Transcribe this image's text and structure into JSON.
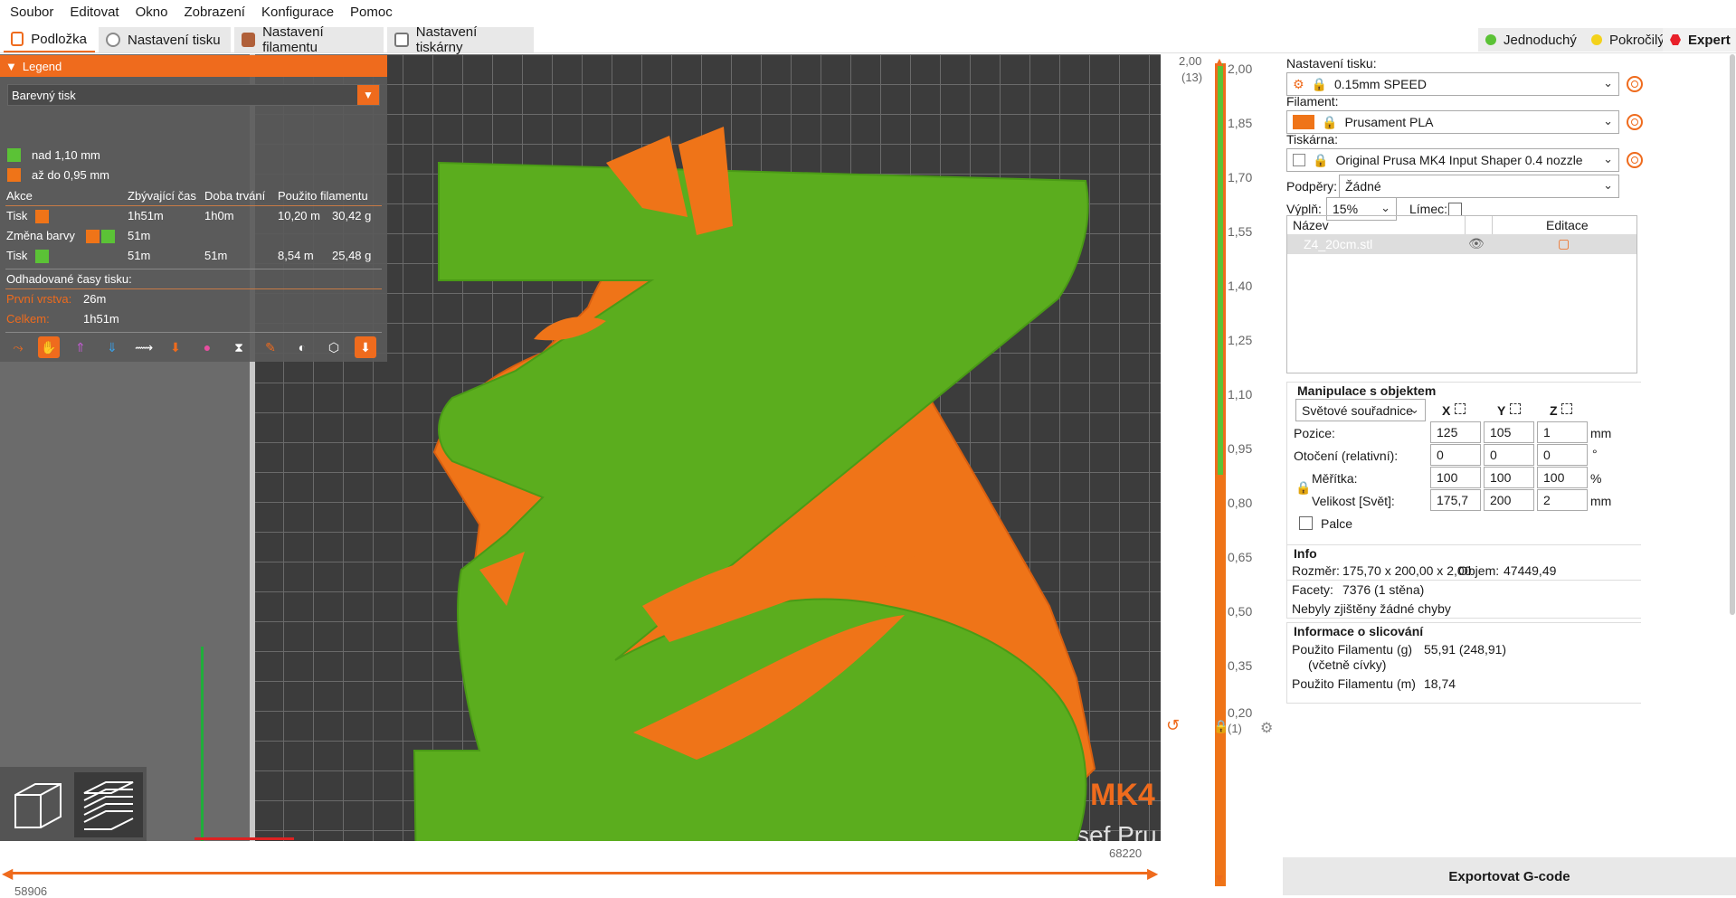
{
  "menu": [
    "Soubor",
    "Editovat",
    "Okno",
    "Zobrazení",
    "Konfigurace",
    "Pomoc"
  ],
  "tabs": [
    {
      "label": "Podložka",
      "active": true
    },
    {
      "label": "Nastavení tisku"
    },
    {
      "label": "Nastavení filamentu"
    },
    {
      "label": "Nastavení tiskárny"
    }
  ],
  "modes": [
    {
      "label": "Jednoduchý",
      "color": "#5bc236"
    },
    {
      "label": "Pokročilý",
      "color": "#f3d21b"
    },
    {
      "label": "Expert",
      "color": "#e8202a"
    }
  ],
  "legend": {
    "title": "Legend",
    "view_type": "Barevný tisk",
    "ranges": [
      {
        "label": "nad 1,10 mm",
        "color": "#5bc236"
      },
      {
        "label": "až do 0,95 mm",
        "color": "#ef7418"
      }
    ],
    "headers": [
      "Akce",
      "Zbývající čas",
      "Doba trvání",
      "Použito filamentu"
    ],
    "rows": [
      {
        "action": "Tisk",
        "remaining": "1h51m",
        "duration": "1h0m",
        "length": "10,20 m",
        "weight": "30,42 g"
      },
      {
        "action": "Změna barvy",
        "remaining": "51m",
        "duration": "",
        "length": "",
        "weight": ""
      },
      {
        "action": "Tisk",
        "remaining": "51m",
        "duration": "51m",
        "length": "8,54 m",
        "weight": "25,48 g"
      }
    ],
    "estimated_label": "Odhadované časy tisku:",
    "first_layer_label": "První vrstva:",
    "first_layer": "26m",
    "total_label": "Celkem:",
    "total": "1h51m"
  },
  "bed": {
    "brand": "MK4",
    "brand2": "sef Pru"
  },
  "hslider": {
    "left": "58906",
    "right": "68220"
  },
  "vslider": {
    "top_value": "2,00",
    "top_layer": "(13)",
    "bottom_value": "0,20",
    "bottom_layer": "(1)",
    "ticks": [
      "2,00",
      "1,85",
      "1,70",
      "1,55",
      "1,40",
      "1,25",
      "1,10",
      "0,95",
      "0,80",
      "0,65",
      "0,50",
      "0,35",
      "0,20"
    ]
  },
  "sidebar": {
    "print_label": "Nastavení tisku:",
    "print_value": "0.15mm SPEED",
    "filament_label": "Filament:",
    "filament_value": "Prusament PLA",
    "filament_color": "#ef7418",
    "printer_label": "Tiskárna:",
    "printer_value": "Original Prusa MK4 Input Shaper 0.4 nozzle",
    "supports_label": "Podpěry:",
    "supports_value": "Žádné",
    "infill_label": "Výplň:",
    "infill_value": "15%",
    "brim_label": "Límec:",
    "objects": {
      "col_name": "Název",
      "col_edit": "Editace",
      "items": [
        {
          "name": "Z4_20cm.stl"
        }
      ]
    },
    "manip": {
      "title": "Manipulace s objektem",
      "coords": "Světové souřadnice",
      "axes": [
        "X",
        "Y",
        "Z"
      ],
      "position_label": "Pozice:",
      "position": [
        "125",
        "105",
        "1"
      ],
      "position_unit": "mm",
      "rotation_label": "Otočení (relativní):",
      "rotation": [
        "0",
        "0",
        "0"
      ],
      "rotation_unit": "°",
      "scale_label": "Měřítka:",
      "scale": [
        "100",
        "100",
        "100"
      ],
      "scale_unit": "%",
      "size_label": "Velikost [Svět]:",
      "size": [
        "175,7",
        "200",
        "2"
      ],
      "size_unit": "mm",
      "inches_label": "Palce"
    },
    "info": {
      "title": "Info",
      "size_label": "Rozměr:",
      "size_value": "175,70 x 200,00 x 2,00",
      "volume_label": "Objem:",
      "volume_value": "47449,49",
      "facets_label": "Facety:",
      "facets_value": "7376 (1 stěna)",
      "errors": "Nebyly zjištěny žádné chyby"
    },
    "slice": {
      "title": "Informace o slicování",
      "g_label": "Použito Filamentu (g)",
      "g_sub": "(včetně cívky)",
      "g_value": "55,91 (248,91)",
      "m_label": "Použito Filamentu (m)",
      "m_value": "18,74"
    },
    "export_label": "Exportovat G-code"
  }
}
